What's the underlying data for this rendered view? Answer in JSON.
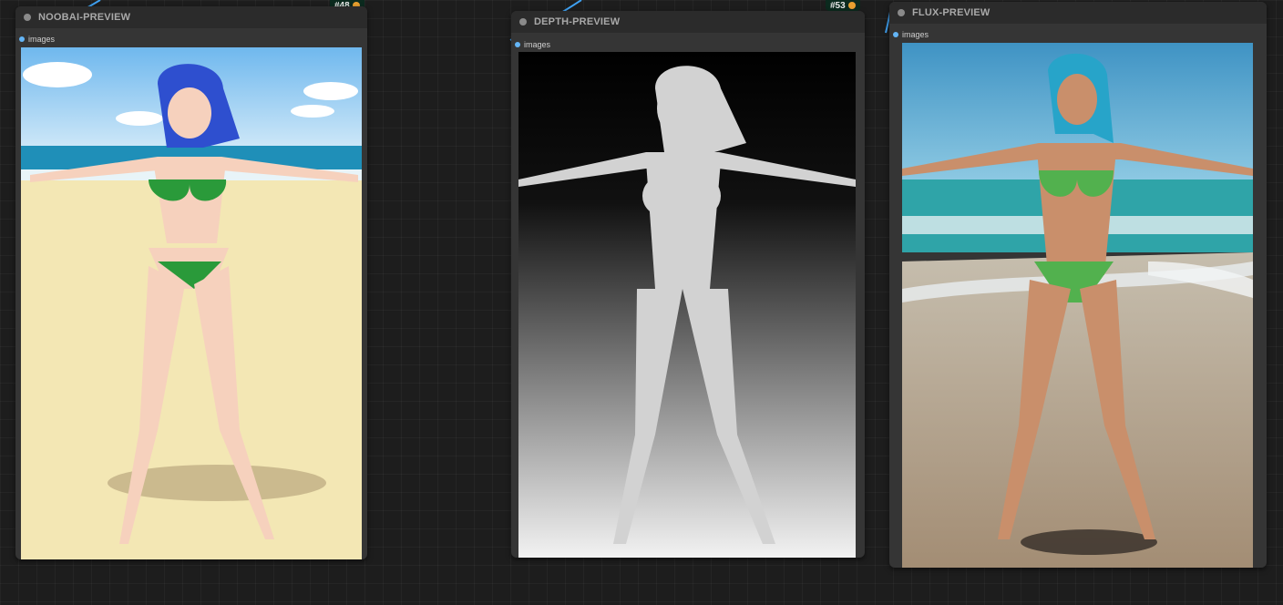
{
  "nodes": [
    {
      "id": "noobai",
      "title": "NOOBAI-PREVIEW",
      "input_label": "images",
      "preview": "anime-style-beach-figure",
      "badge": "#48"
    },
    {
      "id": "depth",
      "title": "DEPTH-PREVIEW",
      "input_label": "images",
      "preview": "depth-map-figure",
      "badge": "#53"
    },
    {
      "id": "flux",
      "title": "FLUX-PREVIEW",
      "input_label": "images",
      "preview": "photo-style-beach-figure",
      "badge": ""
    }
  ],
  "colors": {
    "canvas_bg": "#1d1d1d",
    "node_body": "#353535",
    "node_title_bar": "#2b2b2b",
    "slot_dot": "#64b5f6",
    "link_wire": "#3fa0f0"
  }
}
